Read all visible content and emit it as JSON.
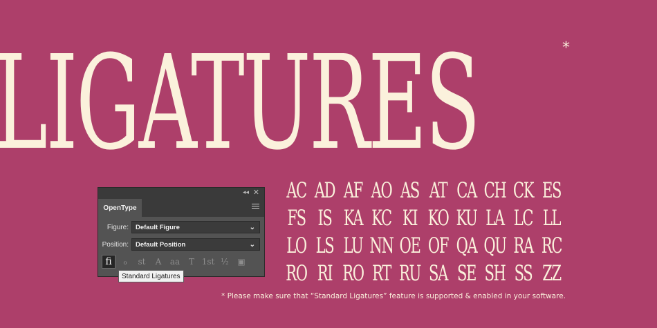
{
  "headline": {
    "text": "LIGATURES",
    "asterisk": "*"
  },
  "ligatures": [
    "AC",
    "AD",
    "AF",
    "AO",
    "AS",
    "AT",
    "CA",
    "CH",
    "CK",
    "ES",
    "FS",
    "IS",
    "KA",
    "KC",
    "KI",
    "KO",
    "KU",
    "LA",
    "LC",
    "LL",
    "LO",
    "LS",
    "LU",
    "NN",
    "OE",
    "OF",
    "QA",
    "QU",
    "RA",
    "RC",
    "RO",
    "RI",
    "RO",
    "RT",
    "RU",
    "SA",
    "SE",
    "SH",
    "SS",
    "ZZ"
  ],
  "panel": {
    "tab_label": "OpenType",
    "collapse_glyph": "◂◂",
    "close_glyph": "✕",
    "figure_label": "Figure:",
    "figure_value": "Default Figure",
    "position_label": "Position:",
    "position_value": "Default Position",
    "chevron": "⌄",
    "buttons": [
      {
        "glyph": "fi",
        "name": "standard-ligatures"
      },
      {
        "glyph": "ℴ",
        "name": "contextual-alternates"
      },
      {
        "glyph": "st",
        "name": "discretionary-ligatures"
      },
      {
        "glyph": "A",
        "name": "swash"
      },
      {
        "glyph": "aa",
        "name": "stylistic-alternates"
      },
      {
        "glyph": "T",
        "name": "titling-alternates"
      },
      {
        "glyph": "1st",
        "name": "ordinals"
      },
      {
        "glyph": "½",
        "name": "fractions"
      },
      {
        "glyph": "▣",
        "name": "stylistic-sets"
      }
    ]
  },
  "tooltip": "Standard Ligatures",
  "footnote": "* Please make sure that “Standard Ligatures” feature is supported & enabled in your software.",
  "colors": {
    "background": "#ad3f6a",
    "cream": "#fbf1dc",
    "panel": "#535353"
  }
}
